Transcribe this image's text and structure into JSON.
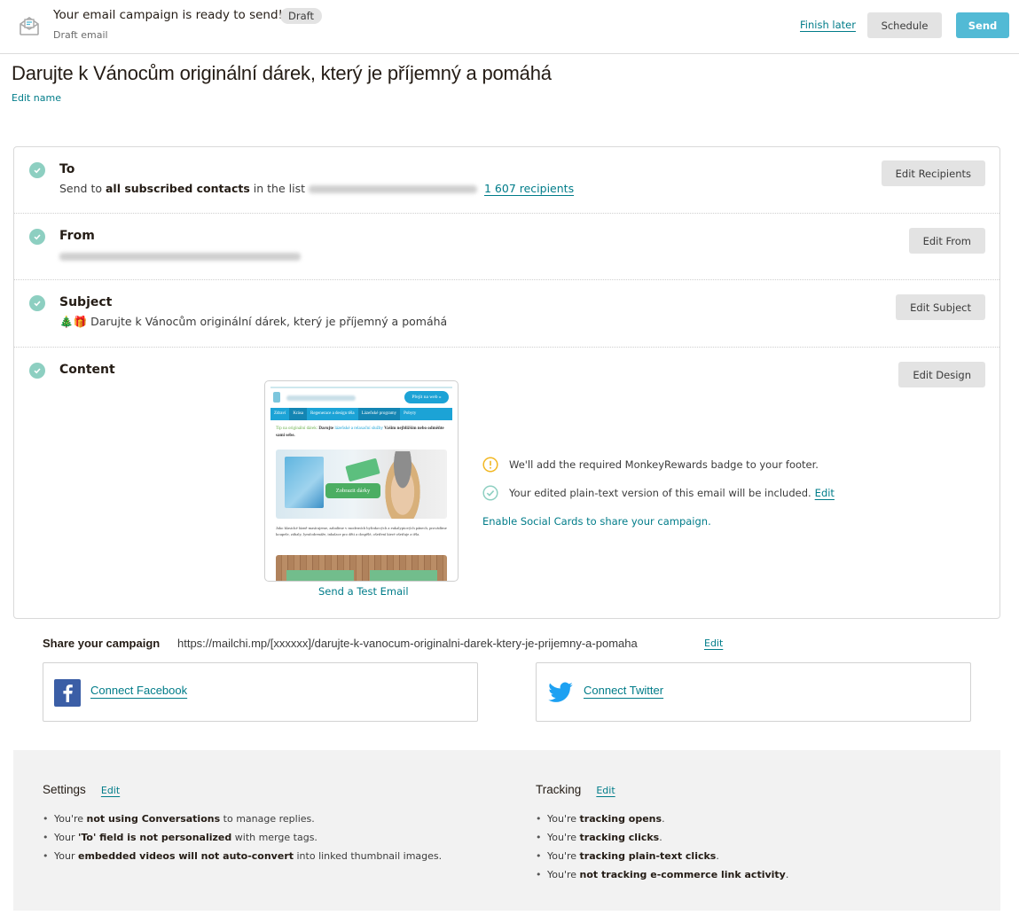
{
  "topbar": {
    "icon": "envelope-icon",
    "title": "Your email campaign is ready to send!",
    "badge": "Draft",
    "subtitle": "Draft email",
    "finish_later": "Finish later",
    "schedule": "Schedule",
    "send": "Send"
  },
  "campaign": {
    "name": "Darujte k Vánocům originální dárek, který je příjemný a pomáhá",
    "edit_name": "Edit name"
  },
  "checklist": {
    "to": {
      "label": "To",
      "prefix": "Send to ",
      "bold": "all subscribed contacts",
      "middle": " in the list",
      "recipients": "1 607 recipients",
      "button": "Edit Recipients"
    },
    "from": {
      "label": "From",
      "button": "Edit From"
    },
    "subject": {
      "label": "Subject",
      "emoji": "🎄🎁",
      "text": "Darujte k Vánocům originální dárek, který je příjemný a pomáhá",
      "button": "Edit Subject"
    },
    "content": {
      "label": "Content",
      "button": "Edit Design",
      "preview": {
        "cta": "Přejít na web »",
        "nav": [
          "Zdraví",
          "Krása",
          "Regenerace a design těla",
          "Lázeňské programy",
          "Pobyty"
        ],
        "tip_green": "Tip na originální dárek:",
        "tip_bold": "Darujte",
        "tip_link": "lázeňské a relaxační služby",
        "tip_rest": "Vašim nejbližším nebo odměňte sami sebe.",
        "hero_button": "Zobrazit dárky",
        "body": "Jako klasické lázně masírujeme, zabalíme v moderních bylinkových a eukalyptových pánech, provádíme koupele, zábaly, lymfodrenáže, inhalace pro děti a dospělé, ošetření které ošetřuje a těla."
      },
      "send_test": "Send a Test Email",
      "notes": [
        {
          "icon": "warning-icon",
          "text": "We'll add the required MonkeyRewards badge to your footer.",
          "link": ""
        },
        {
          "icon": "check-circle-icon",
          "text": "Your edited plain-text version of this email will be included.",
          "link": "Edit"
        }
      ],
      "social_cards": "Enable Social Cards to share your campaign."
    }
  },
  "share": {
    "label": "Share your campaign",
    "url": "https://mailchi.mp/[xxxxxx]/darujte-k-vanocum-originalni-darek-ktery-je-prijemny-a-pomaha",
    "edit": "Edit",
    "facebook": "Connect Facebook",
    "twitter": "Connect Twitter"
  },
  "settings": {
    "title": "Settings",
    "edit": "Edit",
    "items": [
      {
        "pre": "You're ",
        "bold": "not using Conversations",
        "post": " to manage replies."
      },
      {
        "pre": "Your ",
        "bold": "'To' field is not personalized",
        "post": " with merge tags."
      },
      {
        "pre": "Your ",
        "bold": "embedded videos will not auto-convert",
        "post": " into linked thumbnail images."
      }
    ]
  },
  "tracking": {
    "title": "Tracking",
    "edit": "Edit",
    "items": [
      {
        "pre": "You're ",
        "bold": "tracking opens",
        "post": "."
      },
      {
        "pre": "You're ",
        "bold": "tracking clicks",
        "post": "."
      },
      {
        "pre": "You're ",
        "bold": "tracking plain-text clicks",
        "post": "."
      },
      {
        "pre": "You're ",
        "bold": "not tracking e-commerce link activity",
        "post": "."
      }
    ]
  },
  "colors": {
    "accent": "#007c89",
    "send_button": "#52bad5",
    "check": "#8dcfc1",
    "warning": "#f2b721"
  }
}
